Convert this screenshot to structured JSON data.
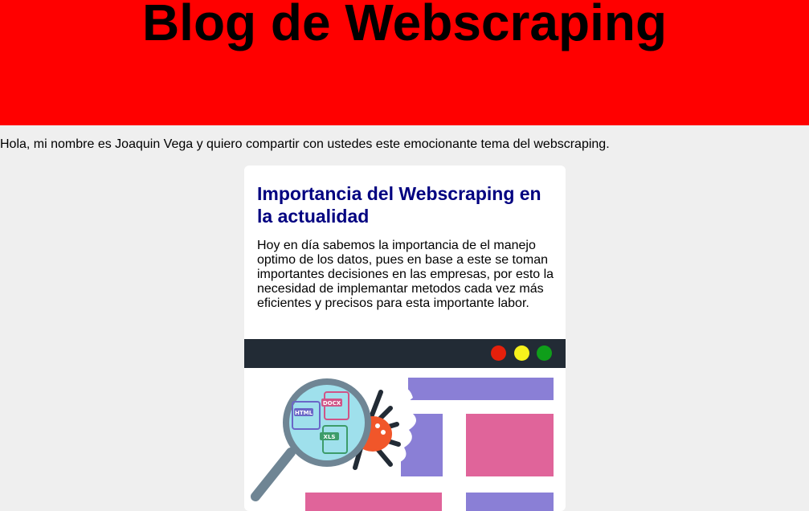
{
  "header": {
    "title": "Blog de Webscraping",
    "bg_color": "#ff0000"
  },
  "intro": {
    "text": "Hola, mi nombre es Joaquin Vega y quiero compartir con ustedes este emocionante tema del webscraping."
  },
  "card": {
    "title": "Importancia del Webscraping en la actualidad",
    "body": "Hoy en día sabemos la importancia de el manejo optimo de los datos, pues en base a este se toman importantes decisiones en las empresas, por esto la necesidad de implemantar metodos cada vez más eficientes y precisos para esta importante labor.",
    "title_color": "#000080"
  },
  "illustration": {
    "window_dots": [
      "red-dot-icon",
      "yellow-dot-icon",
      "green-dot-icon"
    ],
    "dot_colors": [
      "#e5200b",
      "#f7f21c",
      "#0f9e1a"
    ],
    "file_labels": [
      "HTML",
      "DOCX",
      "XLS"
    ],
    "colors": {
      "bar": "#222b35",
      "purple": "#8a7fd6",
      "pink": "#e0649a",
      "lens": "#9fe0ec",
      "handle": "#6f8594",
      "spider_body": "#f1562a"
    }
  }
}
